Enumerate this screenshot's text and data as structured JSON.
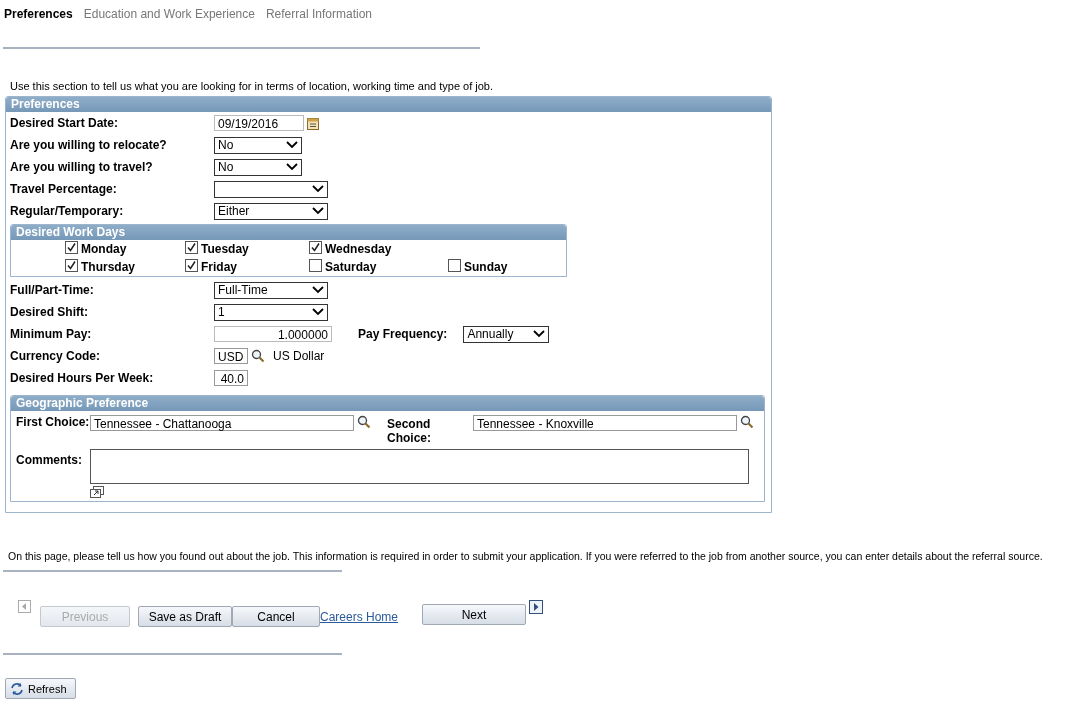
{
  "tabs": [
    {
      "label": "Preferences",
      "selected": true
    },
    {
      "label": "Education and Work Experience",
      "selected": false
    },
    {
      "label": "Referral Information",
      "selected": false
    }
  ],
  "intro": "Use this section to tell us what you are looking for in terms of location, working time and type of job.",
  "preferences": {
    "title": "Preferences",
    "top_fields": [
      {
        "kind": "date",
        "label": "Desired Start Date:",
        "value": "09/19/2016"
      },
      {
        "kind": "select",
        "label": "Are you willing to relocate?",
        "value": "No"
      },
      {
        "kind": "select",
        "label": "Are you willing to travel?",
        "value": "No"
      },
      {
        "kind": "select",
        "label": "Travel Percentage:"
      },
      {
        "kind": "select",
        "label": "Regular/Temporary:",
        "value": "Either"
      }
    ],
    "work_days": {
      "title": "Desired Work Days",
      "rows": [
        [
          {
            "label": "Monday",
            "checked": true
          },
          {
            "label": "Tuesday",
            "checked": true
          },
          {
            "label": "Wednesday",
            "checked": true
          }
        ],
        [
          {
            "label": "Thursday",
            "checked": true
          },
          {
            "label": "Friday",
            "checked": true
          },
          {
            "label": "Saturday",
            "checked": false
          },
          {
            "label": "Sunday",
            "checked": false
          }
        ]
      ]
    },
    "fields": [
      {
        "kind": "select",
        "label": "Full/Part-Time:",
        "value": "Full-Time"
      },
      {
        "kind": "select",
        "label": "Desired Shift:",
        "value": "1"
      },
      {
        "kind": "number",
        "label": "Minimum Pay:",
        "value": "1.000000",
        "side": {
          "label": "Pay Frequency:",
          "value": "Annually"
        }
      },
      {
        "kind": "lookup",
        "label": "Currency Code:",
        "value": "USD",
        "description": "US Dollar"
      },
      {
        "kind": "hours",
        "label": "Desired Hours Per Week:",
        "value": "40.0"
      }
    ],
    "geo": {
      "title": "Geographic Preference",
      "first_choice": {
        "label": "First Choice:",
        "value": "Tennessee - Chattanooga"
      },
      "second_choice": {
        "label": "Second Choice:",
        "value": "Tennessee - Knoxville"
      },
      "comments": {
        "label": "Comments:"
      }
    }
  },
  "footer_text": "On this page, please tell us how you found out about the job.  This information is required in order to submit your application. If you were referred to the job from another source, you can enter details about the referral source.",
  "nav": [
    {
      "kind": "button",
      "label": "Previous",
      "disabled": true
    },
    {
      "kind": "button",
      "label": "Save as Draft",
      "disabled": false
    },
    {
      "kind": "button",
      "label": "Cancel",
      "disabled": false
    },
    {
      "kind": "link",
      "label": "Careers Home",
      "disabled": false
    },
    {
      "kind": "next",
      "label": "Next",
      "disabled": false
    }
  ],
  "refresh": "Refresh"
}
